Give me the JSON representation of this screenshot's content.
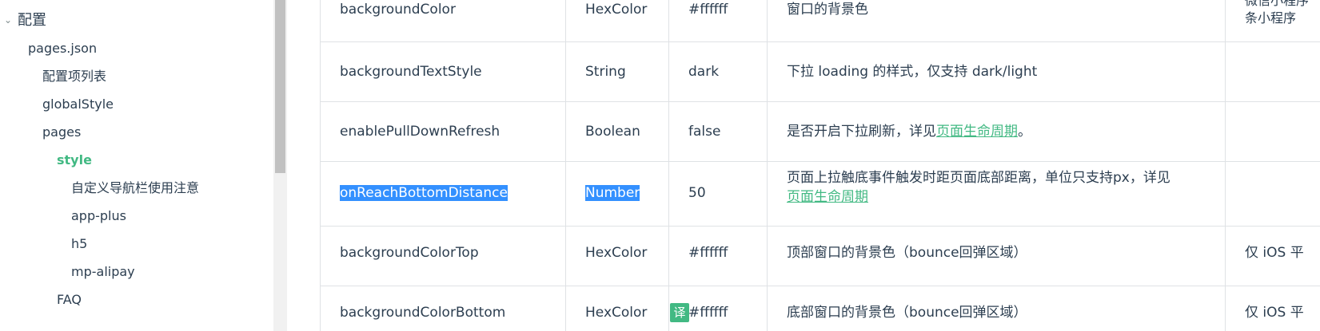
{
  "sidebar": {
    "section_title": "配置",
    "items": [
      {
        "label": "pages.json"
      },
      {
        "label": "配置项列表"
      },
      {
        "label": "globalStyle"
      },
      {
        "label": "pages"
      },
      {
        "label": "style"
      },
      {
        "label": "自定义导航栏使用注意"
      },
      {
        "label": "app-plus"
      },
      {
        "label": "h5"
      },
      {
        "label": "mp-alipay"
      },
      {
        "label": "FAQ"
      }
    ]
  },
  "table": {
    "rows": [
      {
        "name": "backgroundColor",
        "type": "HexColor",
        "default": "#ffffff",
        "desc": "窗口的背景色",
        "platform": "微信小程序",
        "platform2": "条小程序"
      },
      {
        "name": "backgroundTextStyle",
        "type": "String",
        "default": "dark",
        "desc": "下拉 loading 的样式，仅支持 dark/light",
        "platform": ""
      },
      {
        "name": "enablePullDownRefresh",
        "type": "Boolean",
        "default": "false",
        "desc_pre": "是否开启下拉刷新，详见",
        "desc_link": "页面生命周期",
        "desc_post": "。",
        "platform": ""
      },
      {
        "name": "onReachBottomDistance",
        "type": "Number",
        "default": "50",
        "desc_pre": "页面上拉触底事件触发时距页面底部距离，单位只支持px，详见",
        "desc_link": "页面生命周期",
        "platform": ""
      },
      {
        "name": "backgroundColorTop",
        "type": "HexColor",
        "default": "#ffffff",
        "desc": "顶部窗口的背景色（bounce回弹区域）",
        "platform": "仅 iOS 平"
      },
      {
        "name": "backgroundColorBottom",
        "type": "HexColor",
        "default": "#ffffff",
        "desc": "底部窗口的背景色（bounce回弹区域）",
        "platform": "仅 iOS 平"
      }
    ]
  },
  "translate_badge": "译",
  "colors": {
    "accent": "#42b983",
    "selection": "#3390ff",
    "text": "#2c3e50"
  }
}
